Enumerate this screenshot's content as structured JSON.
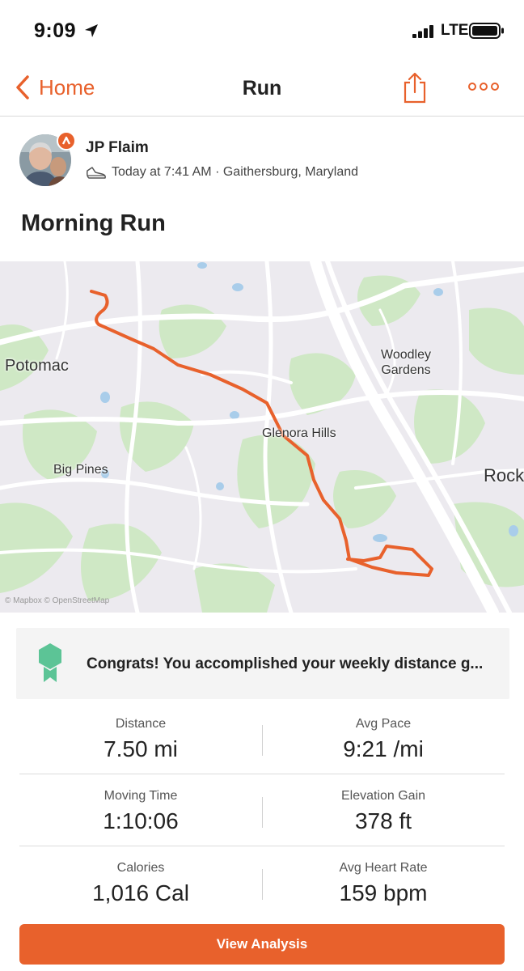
{
  "status_bar": {
    "time": "9:09",
    "network": "LTE"
  },
  "nav": {
    "back_label": "Home",
    "title": "Run"
  },
  "athlete": {
    "name": "JP Flaim",
    "meta": "Today at 7:41 AM · Gaithersburg, Maryland"
  },
  "activity": {
    "title": "Morning Run"
  },
  "map": {
    "labels": {
      "potomac": "Potomac",
      "woodley": "Woodley Gardens",
      "glenora": "Glenora Hills",
      "big_pines": "Big Pines",
      "rock": "Rock"
    },
    "attribution": "© Mapbox © OpenStreetMap",
    "route_color": "#e8612c"
  },
  "goal": {
    "text": "Congrats! You accomplished your weekly distance g..."
  },
  "stats": [
    {
      "left_label": "Distance",
      "left_value": "7.50 mi",
      "right_label": "Avg Pace",
      "right_value": "9:21 /mi"
    },
    {
      "left_label": "Moving Time",
      "left_value": "1:10:06",
      "right_label": "Elevation Gain",
      "right_value": "378 ft"
    },
    {
      "left_label": "Calories",
      "left_value": "1,016 Cal",
      "right_label": "Avg Heart Rate",
      "right_value": "159 bpm"
    }
  ],
  "actions": {
    "view_analysis": "View Analysis"
  },
  "colors": {
    "brand": "#e8612c",
    "goal_icon": "#5cc496"
  }
}
